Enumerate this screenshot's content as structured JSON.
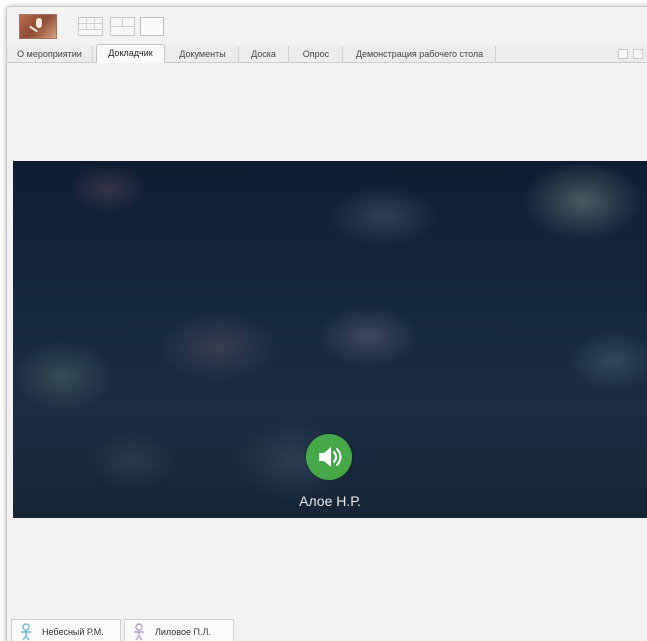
{
  "tabs": [
    {
      "label": "О мероприятии",
      "active": false
    },
    {
      "label": "Докладчик",
      "active": true
    },
    {
      "label": "Документы",
      "active": false
    },
    {
      "label": "Доска",
      "active": false
    },
    {
      "label": "Опрос",
      "active": false
    },
    {
      "label": "Демонстрация рабочего стола",
      "active": false
    }
  ],
  "toolbar": {
    "avatar_icon": "presenter-avatar-thumbnail",
    "layouts": [
      "grid-3x3-icon",
      "grid-2x2-icon",
      "single-view-icon"
    ],
    "active_layout": "single-view-icon"
  },
  "video": {
    "speaker_name": "Алое Н.Р.",
    "audio_icon": "speaker-volume-icon",
    "audio_color": "#47a84a"
  },
  "participants": [
    {
      "name": "Небесный Р.М.",
      "icon": "person-icon",
      "color": "#6fb6d6"
    },
    {
      "name": "Лиловое П.Л.",
      "icon": "person-icon",
      "color": "#b7a5c9"
    }
  ]
}
